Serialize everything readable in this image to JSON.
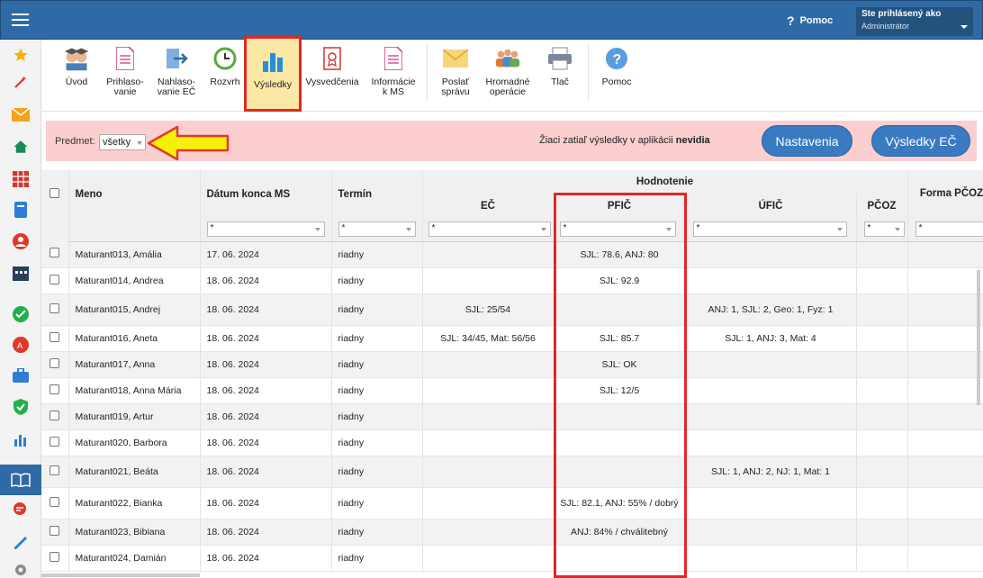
{
  "header": {
    "help_label": "Pomoc",
    "user_line1": "Ste prihlásený ako",
    "user_line2": "Administrátor"
  },
  "rail_icons": [
    "star-icon",
    "magic-wand-icon",
    "mail-icon",
    "home-icon",
    "calendar-grid-icon",
    "book-icon",
    "person-icon",
    "calendar-icon",
    "check-icon",
    "grade-icon",
    "briefcase-icon",
    "shield-icon",
    "chart-icon",
    "open-book-icon",
    "chat-icon",
    "pen-icon",
    "gear-icon"
  ],
  "toolbar": {
    "items": [
      {
        "label": "Úvod",
        "icon": "students-icon"
      },
      {
        "label": "Prihlaso-\nvanie",
        "icon": "form-icon"
      },
      {
        "label": "Nahlaso-\nvanie EČ",
        "icon": "export-icon"
      },
      {
        "label": "Rozvrh",
        "icon": "clock-icon"
      },
      {
        "label": "Výsledky",
        "icon": "bar-chart-icon"
      },
      {
        "label": "Vysvedčenia",
        "icon": "certificate-icon"
      },
      {
        "label": "Informácie\nk MS",
        "icon": "document-icon"
      },
      {
        "label": "Poslať\nsprávu",
        "icon": "envelope-icon"
      },
      {
        "label": "Hromadné\noperácie",
        "icon": "group-icon"
      },
      {
        "label": "Tlač",
        "icon": "printer-icon"
      },
      {
        "label": "Pomoc",
        "icon": "help-icon"
      }
    ]
  },
  "filter": {
    "predmet_label": "Predmet:",
    "predmet_value": "všetky",
    "info_text": "Žiaci zatiaľ výsledky v aplikácii ",
    "info_bold": "nevidia",
    "btn_settings": "Nastavenia",
    "btn_results": "Výsledky EČ"
  },
  "table": {
    "headers": {
      "meno": "Meno",
      "datum": "Dátum konca MS",
      "termin": "Termín",
      "hodnotenie": "Hodnotenie",
      "ec": "EČ",
      "pfic": "PFIČ",
      "ufic": "ÚFIČ",
      "pcoz": "PČOZ",
      "forma": "Forma PČOZ"
    },
    "filter_placeholder": "*",
    "rows": [
      {
        "meno": "Maturant013, Amália",
        "datum": "17. 06. 2024",
        "termin": "riadny",
        "ec": "",
        "pfic": "SJL: 78.6, ANJ: 80",
        "ufic": "",
        "h": 29
      },
      {
        "meno": "Maturant014, Andrea",
        "datum": "18. 06. 2024",
        "termin": "riadny",
        "ec": "",
        "pfic": "SJL: 92.9",
        "ufic": "",
        "h": 29
      },
      {
        "meno": "Maturant015, Andrej",
        "datum": "18. 06. 2024",
        "termin": "riadny",
        "ec": "SJL: 25/54",
        "pfic": "",
        "ufic": "ANJ: 1, SJL: 2, Geo: 1, Fyz: 1",
        "h": 35
      },
      {
        "meno": "Maturant016, Aneta",
        "datum": "18. 06. 2024",
        "termin": "riadny",
        "ec": "SJL: 34/45, Mat: 56/56",
        "pfic": "SJL: 85.7",
        "ufic": "SJL: 1, ANJ: 3, Mat: 4",
        "h": 29
      },
      {
        "meno": "Maturant017, Anna",
        "datum": "18. 06. 2024",
        "termin": "riadny",
        "ec": "",
        "pfic": "SJL: OK",
        "ufic": "",
        "h": 29
      },
      {
        "meno": "Maturant018, Anna Mária",
        "datum": "18. 06. 2024",
        "termin": "riadny",
        "ec": "",
        "pfic": "SJL: 12/5",
        "ufic": "",
        "h": 29
      },
      {
        "meno": "Maturant019, Artur",
        "datum": "18. 06. 2024",
        "termin": "riadny",
        "ec": "",
        "pfic": "",
        "ufic": "",
        "h": 29
      },
      {
        "meno": "Maturant020, Barbora",
        "datum": "18. 06. 2024",
        "termin": "riadny",
        "ec": "",
        "pfic": "",
        "ufic": "",
        "h": 29
      },
      {
        "meno": "Maturant021, Beáta",
        "datum": "18. 06. 2024",
        "termin": "riadny",
        "ec": "",
        "pfic": "",
        "ufic": "SJL: 1, ANJ: 2, NJ: 1, Mat: 1",
        "h": 35
      },
      {
        "meno": "Maturant022, Bianka",
        "datum": "18. 06. 2024",
        "termin": "riadny",
        "ec": "",
        "pfic": "SJL: 82.1, ANJ: 55% / dobrý",
        "ufic": "",
        "h": 35
      },
      {
        "meno": "Maturant023, Bibiana",
        "datum": "18. 06. 2024",
        "termin": "riadny",
        "ec": "",
        "pfic": "ANJ: 84% / chválitebný",
        "ufic": "",
        "h": 29
      },
      {
        "meno": "Maturant024, Damián",
        "datum": "18. 06. 2024",
        "termin": "riadny",
        "ec": "",
        "pfic": "",
        "ufic": "",
        "h": 29
      }
    ]
  },
  "colors": {
    "topbar": "#2f6aa6",
    "banner": "#fbcfd0",
    "button": "#3a7ac0",
    "highlight": "#e02727",
    "arrow_fill": "#f7f00a"
  }
}
